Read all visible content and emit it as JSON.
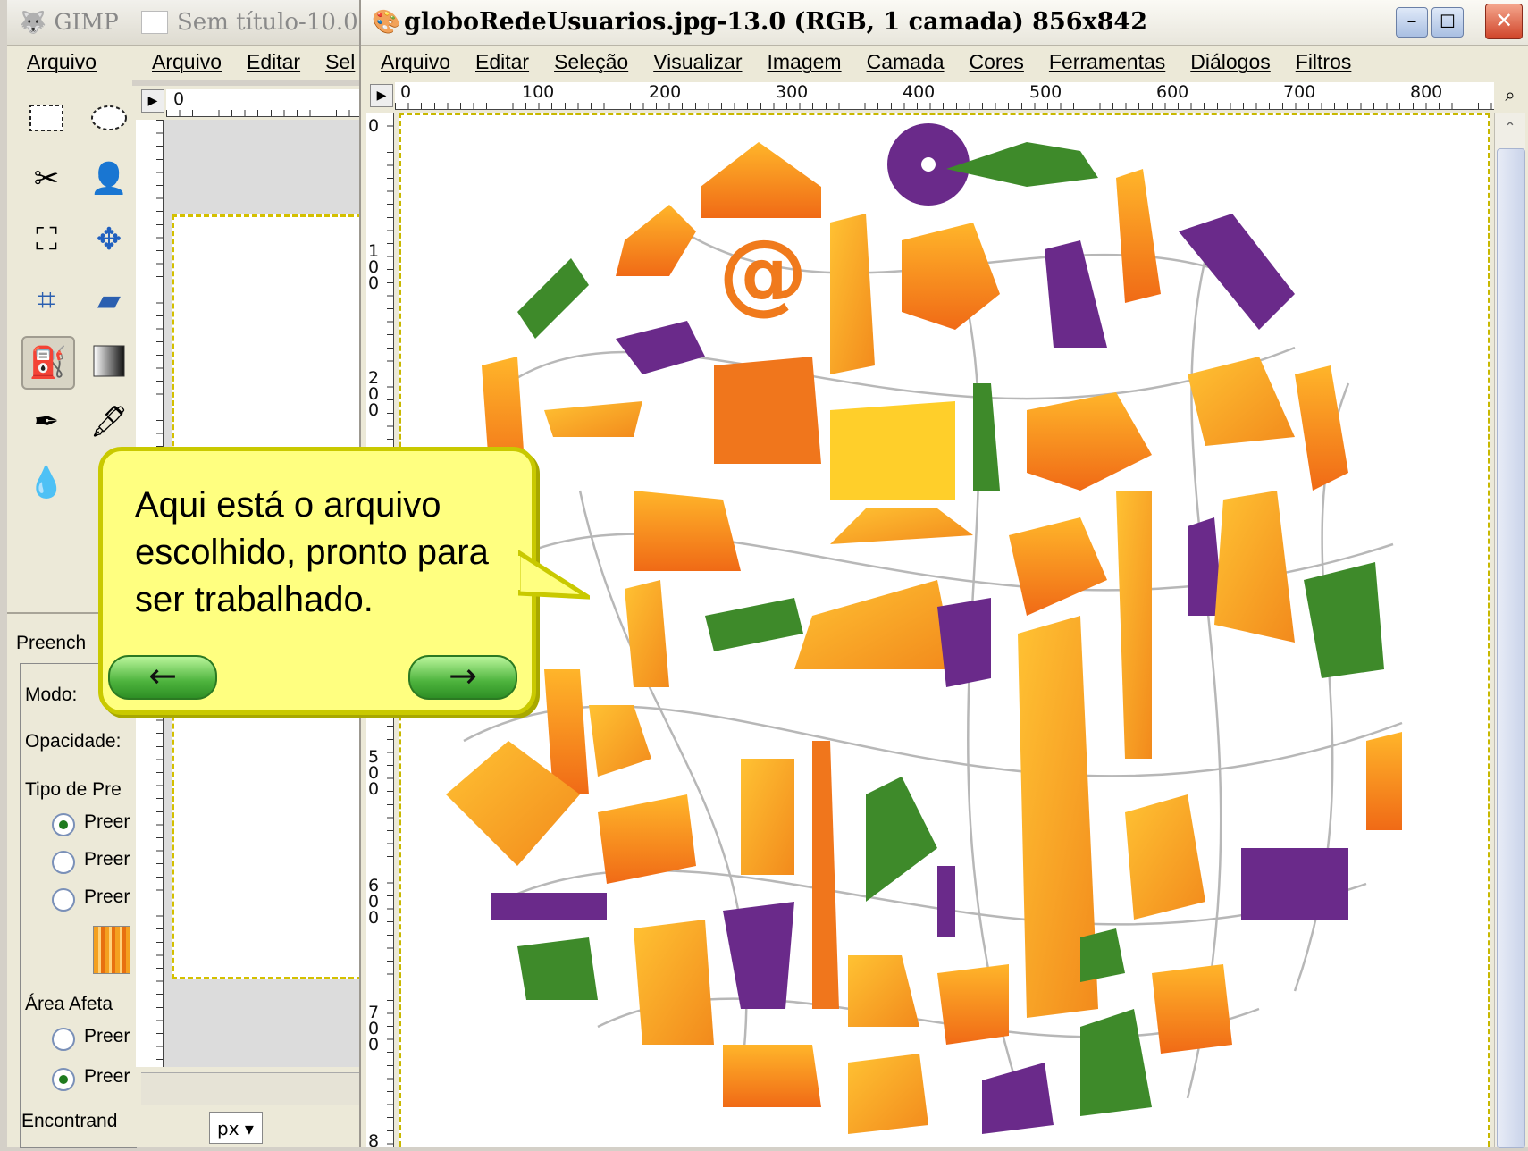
{
  "toolbox": {
    "title": "GIMP",
    "menu_label": "Arquivo",
    "panel_title": "Preench",
    "mode_label": "Modo:",
    "opacity_label": "Opacidade:",
    "fill_type_label": "Tipo de Pre",
    "fill_options": [
      "Preer",
      "Preer",
      "Preer"
    ],
    "area_label": "Área Afeta",
    "area_options": [
      "Preer",
      "Preer"
    ],
    "finding_label": "Encontrand"
  },
  "blank_window": {
    "title": "Sem título-10.0",
    "menu": [
      "Arquivo",
      "Editar",
      "Sel"
    ],
    "unit": "px"
  },
  "main_window": {
    "title": "globoRedeUsuarios.jpg-13.0 (RGB, 1 camada) 856x842",
    "menu": [
      "Arquivo",
      "Editar",
      "Seleção",
      "Visualizar",
      "Imagem",
      "Camada",
      "Cores",
      "Ferramentas",
      "Diálogos",
      "Filtros"
    ],
    "ruler_h": [
      "0",
      "100",
      "200",
      "300",
      "400",
      "500",
      "600",
      "700",
      "800"
    ],
    "ruler_v": [
      "0",
      "100",
      "200",
      "500",
      "600",
      "700",
      "8"
    ]
  },
  "callout": {
    "text": "Aqui está o arquivo escolhido, pronto para ser trabalhado.",
    "prev": "←",
    "next": "→"
  }
}
